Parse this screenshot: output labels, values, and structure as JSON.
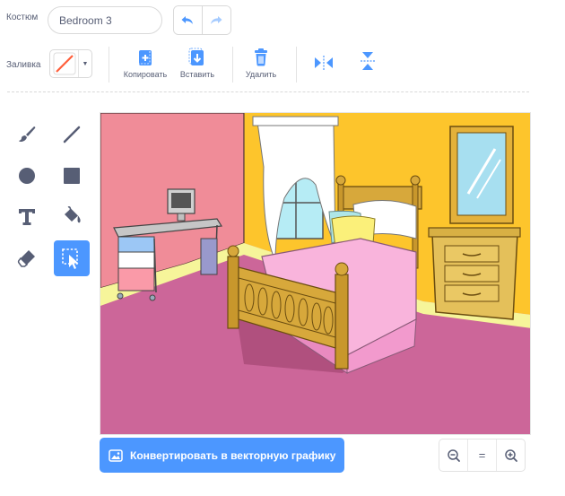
{
  "costume": {
    "label": "Костюм",
    "name_value": "Bedroom 3",
    "undo_icon": "undo-icon",
    "redo_icon": "redo-icon"
  },
  "fill": {
    "label": "Заливка",
    "color": "#ff5e3a",
    "dropdown_icon": "chevron-down-icon"
  },
  "actions": {
    "copy_label": "Копировать",
    "paste_label": "Вставить",
    "delete_label": "Удалить",
    "flip_horizontal_icon": "flip-horizontal-icon",
    "flip_vertical_icon": "flip-vertical-icon"
  },
  "tools": [
    {
      "name": "brush",
      "icon": "brush-icon",
      "selected": false
    },
    {
      "name": "line",
      "icon": "line-icon",
      "selected": false
    },
    {
      "name": "circle",
      "icon": "circle-icon",
      "selected": false
    },
    {
      "name": "rectangle",
      "icon": "rectangle-icon",
      "selected": false
    },
    {
      "name": "text",
      "icon": "text-icon",
      "selected": false
    },
    {
      "name": "fill",
      "icon": "fill-bucket-icon",
      "selected": false
    },
    {
      "name": "eraser",
      "icon": "eraser-icon",
      "selected": false
    },
    {
      "name": "select",
      "icon": "select-icon",
      "selected": true
    }
  ],
  "bottom": {
    "convert_label": "Конвертировать в векторную графику",
    "zoom_out_icon": "zoom-out-icon",
    "zoom_reset_label": "=",
    "zoom_in_icon": "zoom-in-icon"
  },
  "colors": {
    "accent": "#4c97ff",
    "text": "#575e75"
  }
}
